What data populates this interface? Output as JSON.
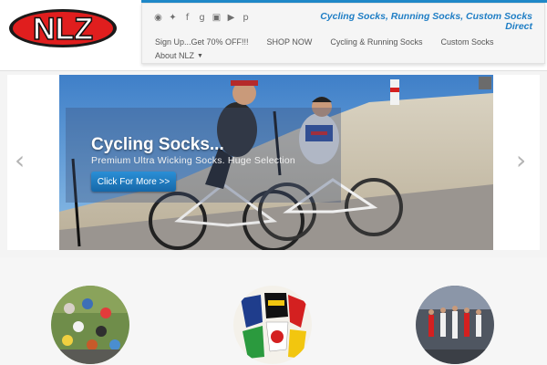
{
  "brand": {
    "logo_text": "NLZ"
  },
  "header": {
    "tagline": "Cycling Socks, Running Socks, Custom Socks Direct",
    "social_icons": [
      {
        "name": "rss-icon",
        "glyph": "◉"
      },
      {
        "name": "twitter-icon",
        "glyph": "✦"
      },
      {
        "name": "facebook-icon",
        "glyph": "f"
      },
      {
        "name": "google-plus-icon",
        "glyph": "g"
      },
      {
        "name": "instagram-icon",
        "glyph": "▣"
      },
      {
        "name": "youtube-icon",
        "glyph": "▶"
      },
      {
        "name": "pinterest-icon",
        "glyph": "p"
      }
    ]
  },
  "nav": {
    "items": [
      {
        "label": "Sign Up...Get 70% OFF!!!"
      },
      {
        "label": "SHOP NOW"
      },
      {
        "label": "Cycling & Running Socks"
      },
      {
        "label": "Custom Socks"
      }
    ],
    "about": {
      "label": "About NLZ"
    }
  },
  "slider": {
    "title": "Cycling Socks...",
    "subtitle": "Premium Ultra Wicking Socks. Huge Selection",
    "cta_label": "Click For More >>",
    "prev_glyph": "‹",
    "next_glyph": "›"
  },
  "colors": {
    "accent": "#1f7ec5",
    "logo_red": "#e01e1e",
    "button_blue": "#1e7cc4"
  }
}
